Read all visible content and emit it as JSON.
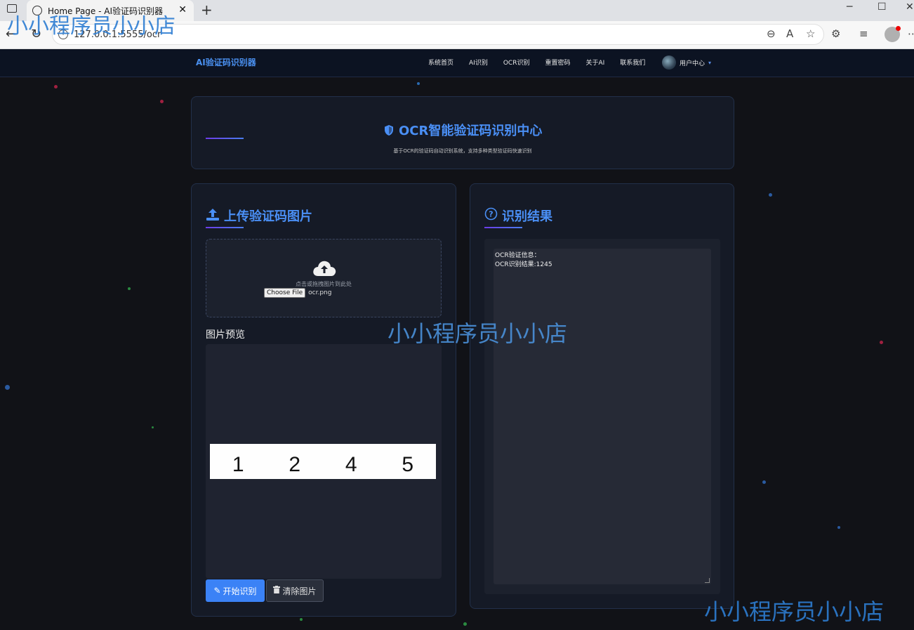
{
  "browser": {
    "tab_title": "Home Page - AI验证码识别器",
    "url": "127.0.0.1:5555/ocr"
  },
  "watermark": "小小程序员小小店",
  "nav": {
    "brand": "AI验证码识别器",
    "links": [
      "系统首页",
      "AI识别",
      "OCR识别",
      "重置密码",
      "关于AI",
      "联系我们"
    ],
    "user_center": "用户中心"
  },
  "hero": {
    "title": "OCR智能验证码识别中心",
    "subtitle": "基于OCR的验证码自动识别系统，支持多种类型验证码快速识别"
  },
  "upload": {
    "title": "上传验证码图片",
    "hint": "点击或拖拽图片到此处",
    "choose_file": "Choose File",
    "file_name": "ocr.png",
    "preview_label": "图片预览",
    "captcha_digits": [
      "1",
      "2",
      "4",
      "5"
    ],
    "start_button": "开始识别",
    "clear_button": "清除图片"
  },
  "result": {
    "title": "识别结果",
    "lines": [
      "OCR验证信息：",
      "OCR识别结果:1245"
    ]
  },
  "colors": {
    "accent": "#4a8ff5",
    "background": "#111217",
    "panel": "#151a26"
  }
}
